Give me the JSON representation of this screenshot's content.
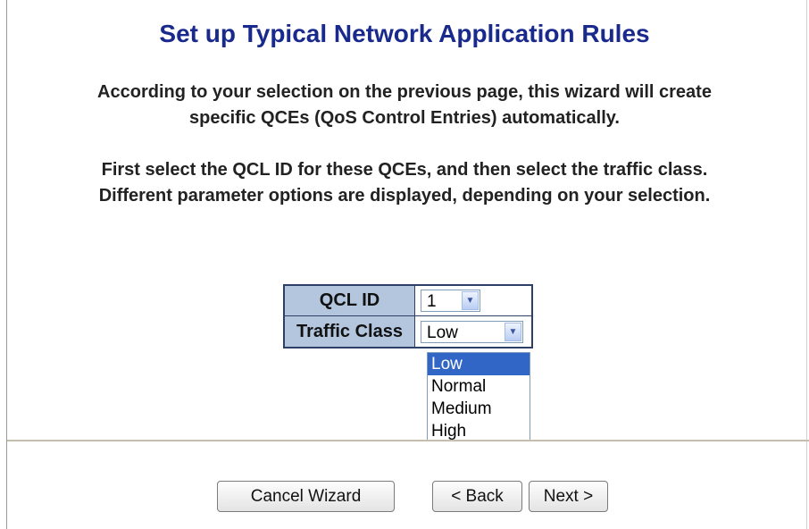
{
  "title": "Set up Typical Network Application Rules",
  "description": {
    "line1": "According to your selection on the previous page, this wizard will create",
    "line2": "specific QCEs (QoS Control Entries) automatically.",
    "line3": "First select the QCL ID for these QCEs, and then select the traffic class.",
    "line4": "Different parameter options are displayed, depending on your selection."
  },
  "form": {
    "qcl_id_label": "QCL ID",
    "qcl_id_value": "1",
    "traffic_class_label": "Traffic Class",
    "traffic_class_value": "Low",
    "traffic_class_options": [
      "Low",
      "Normal",
      "Medium",
      "High"
    ],
    "traffic_class_highlighted": "Low"
  },
  "buttons": {
    "cancel": "Cancel Wizard",
    "back": "< Back",
    "next": "Next >"
  },
  "colors": {
    "title": "#1a2a8c",
    "label_bg": "#b4c6de",
    "highlight": "#3166c7"
  },
  "icons": {
    "dropdown_arrow": "chevron-down-icon"
  }
}
